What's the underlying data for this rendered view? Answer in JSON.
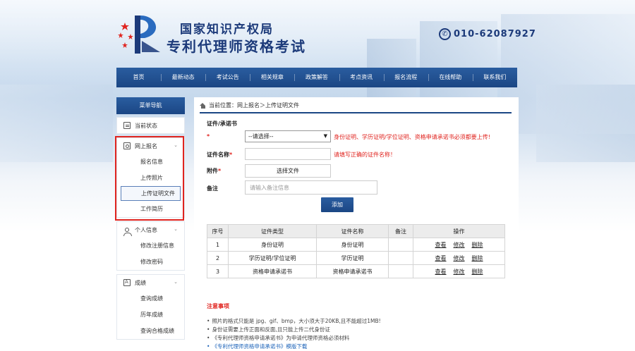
{
  "header": {
    "title_line1": "国家知识产权局",
    "title_line2": "专利代理师资格考试",
    "phone": "010-62087927",
    "phone_icon": "phone-icon"
  },
  "nav": {
    "items": [
      "首页",
      "最新动态",
      "考试公告",
      "相关规章",
      "政策解答",
      "考点资讯",
      "报名流程",
      "在线帮助",
      "联系我们"
    ]
  },
  "sidebar": {
    "header": "菜单导航",
    "status": "当前状态",
    "online": {
      "label": "网上报名",
      "items": [
        "报名信息",
        "上传照片",
        "上传证明文件",
        "工作简历"
      ]
    },
    "personal": {
      "label": "个人信息",
      "items": [
        "修改注册信息",
        "修改密码"
      ]
    },
    "score": {
      "label": "成绩",
      "items": [
        "查询成绩",
        "历年成绩",
        "查询合格成绩"
      ]
    }
  },
  "main": {
    "breadcrumb": "当前位置：网上报名＞上传证明文件",
    "form": {
      "section_label": "证件/承诺书",
      "required_mark": "*",
      "select_value": "--请选择--",
      "select_hint": "身份证明、学历证明/学位证明、资格申请承诺书必须都要上传!",
      "name_label": "证件名称",
      "name_hint": "请填写正确的证件名称！",
      "attach_label": "附件",
      "choose_file": "选择文件",
      "remark_label": "备注",
      "remark_placeholder": "请输入备注信息",
      "add_button": "添加"
    },
    "table": {
      "headers": [
        "序号",
        "证件类型",
        "证件名称",
        "备注",
        "操作"
      ],
      "rows": [
        {
          "no": "1",
          "type": "身份证明",
          "name": "身份证明",
          "remark": ""
        },
        {
          "no": "2",
          "type": "学历证明/学位证明",
          "name": "学历证明",
          "remark": ""
        },
        {
          "no": "3",
          "type": "资格申请承诺书",
          "name": "资格申请承诺书",
          "remark": ""
        }
      ],
      "ops": [
        "查看",
        "修改",
        "删除"
      ]
    },
    "notice": {
      "title": "注意事项",
      "items": [
        "照片的格式只能是 jpg、gif、bmp，大小须大于20KB,且不能超过1MB!",
        "身份证需要上传正面和反面,且只能上传二代身份证",
        "《专利代理师资格申请承诺书》为申请代理师资格必须材料",
        "《专利代理师资格申请承诺书》模版下载"
      ]
    }
  },
  "colors": {
    "brand_blue": "#1b4684",
    "alert_red": "#e0241f",
    "link_blue": "#1b62b8"
  }
}
